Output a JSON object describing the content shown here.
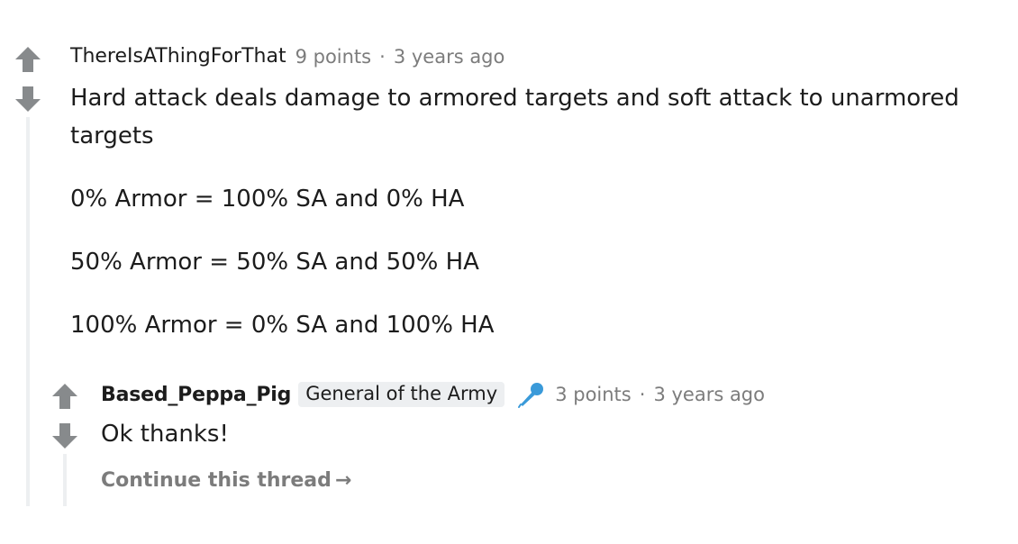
{
  "comment": {
    "author": "ThereIsAThingForThat",
    "points": "9 points",
    "separator": "·",
    "age": "3 years ago",
    "paragraphs": [
      "Hard attack deals damage to armored targets and soft attack to unarmored targets",
      "0% Armor = 100% SA and 0% HA",
      "50% Armor = 50% SA and 50% HA",
      "100% Armor = 0% SA and 100% HA"
    ]
  },
  "reply": {
    "author": "Based_Peppa_Pig",
    "flair": "General of the Army",
    "flair_icon": "microphone-icon",
    "points": "3 points",
    "separator": "·",
    "age": "3 years ago",
    "text": "Ok thanks!",
    "continue_label": "Continue this thread",
    "continue_arrow": "→"
  },
  "colors": {
    "vote_arrow": "#878a8c",
    "thread_line": "#edeff1",
    "meta_text": "#7c7c7c",
    "mic_icon": "#3a9ad9"
  }
}
